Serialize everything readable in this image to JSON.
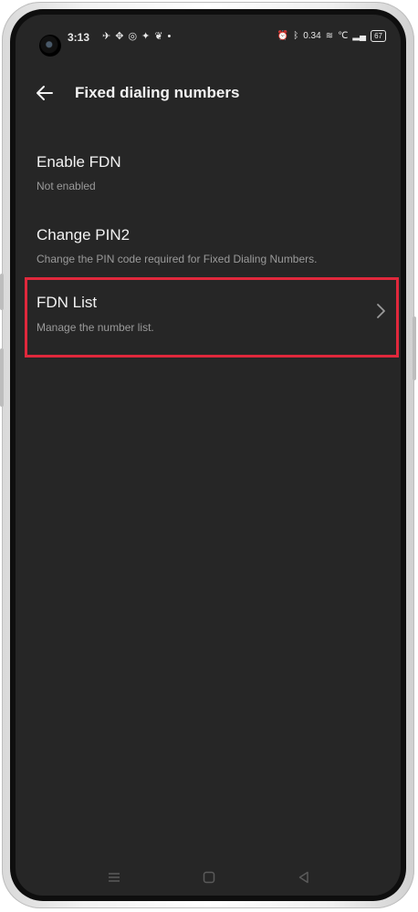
{
  "status_bar": {
    "time": "3:13",
    "notification_icons": [
      "signal-app-icon",
      "maps-icon",
      "threads-icon",
      "twitter-icon",
      "leaf-icon",
      "dot-icon"
    ],
    "system_icons": [
      "alarm-icon",
      "bluetooth-icon",
      "data-speed-icon",
      "wifi-icon",
      "volte-icon",
      "signal-bars-icon"
    ],
    "data_speed": "0.34",
    "battery": "67"
  },
  "app_bar": {
    "title": "Fixed dialing numbers",
    "back_icon": "arrow-left-icon"
  },
  "settings": [
    {
      "title": "Enable FDN",
      "subtitle": "Not enabled"
    },
    {
      "title": "Change PIN2",
      "subtitle": "Change the PIN code required for Fixed Dialing Numbers."
    },
    {
      "title": "FDN List",
      "subtitle": "Manage the number list.",
      "highlighted": true,
      "highlight_color": "#e0283c"
    }
  ],
  "nav_bar": [
    "menu-icon",
    "home-icon",
    "back-icon"
  ],
  "colors": {
    "background": "#262626",
    "text_primary": "#f2f2f2",
    "text_secondary": "#9a9a9a",
    "highlight": "#e0283c"
  }
}
